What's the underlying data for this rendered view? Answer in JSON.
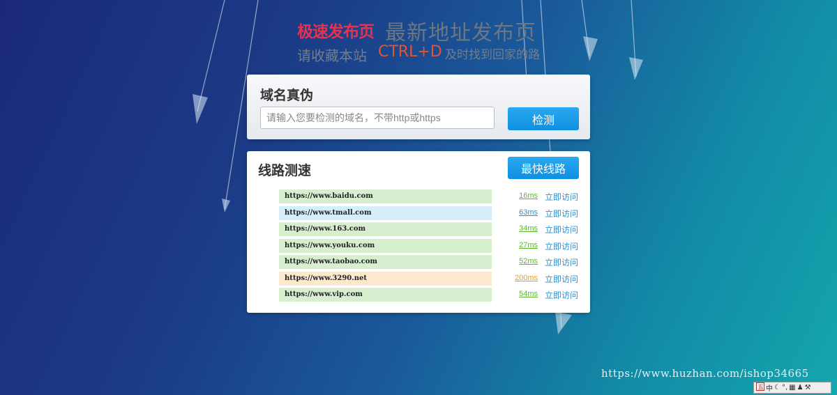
{
  "header": {
    "tag": "极速发布页",
    "title": "最新地址发布页",
    "subtitle_prefix": "请收藏本站",
    "subtitle_key": "CTRL+D",
    "subtitle_suffix": "及时找到回家的路"
  },
  "domain_check": {
    "title": "域名真伪",
    "input_placeholder": "请输入您要检测的域名，不带http或https",
    "input_value": "",
    "button_label": "检测"
  },
  "speed_test": {
    "title": "线路测速",
    "fastest_button_label": "最快线路",
    "visit_label": "立即访问",
    "rows": [
      {
        "url": "https://www.baidu.com",
        "latency": "16ms",
        "bar_color": "#d7efcf",
        "latency_color": "#5cb82a"
      },
      {
        "url": "https://www.tmall.com",
        "latency": "63ms",
        "bar_color": "#d5eef9",
        "latency_color": "#2b8fd6"
      },
      {
        "url": "https://www.163.com",
        "latency": "34ms",
        "bar_color": "#d7efcf",
        "latency_color": "#5cb82a"
      },
      {
        "url": "https://www.youku.com",
        "latency": "27ms",
        "bar_color": "#d7efcf",
        "latency_color": "#5cb82a"
      },
      {
        "url": "https://www.taobao.com",
        "latency": "52ms",
        "bar_color": "#d7efcf",
        "latency_color": "#5cb82a"
      },
      {
        "url": "https://www.3290.net",
        "latency": "200ms",
        "bar_color": "#fde9cf",
        "latency_color": "#f09a1a"
      },
      {
        "url": "https://www.vip.com",
        "latency": "54ms",
        "bar_color": "#d7efcf",
        "latency_color": "#5cb82a"
      }
    ]
  },
  "watermark": "https://www.huzhan.com/ishop34665",
  "ime_toolbar": {
    "mode_label": "中",
    "icons": [
      "ime-logo-icon",
      "moon-icon",
      "punctuation-icon",
      "keyboard-icon",
      "user-icon",
      "wrench-icon"
    ]
  }
}
